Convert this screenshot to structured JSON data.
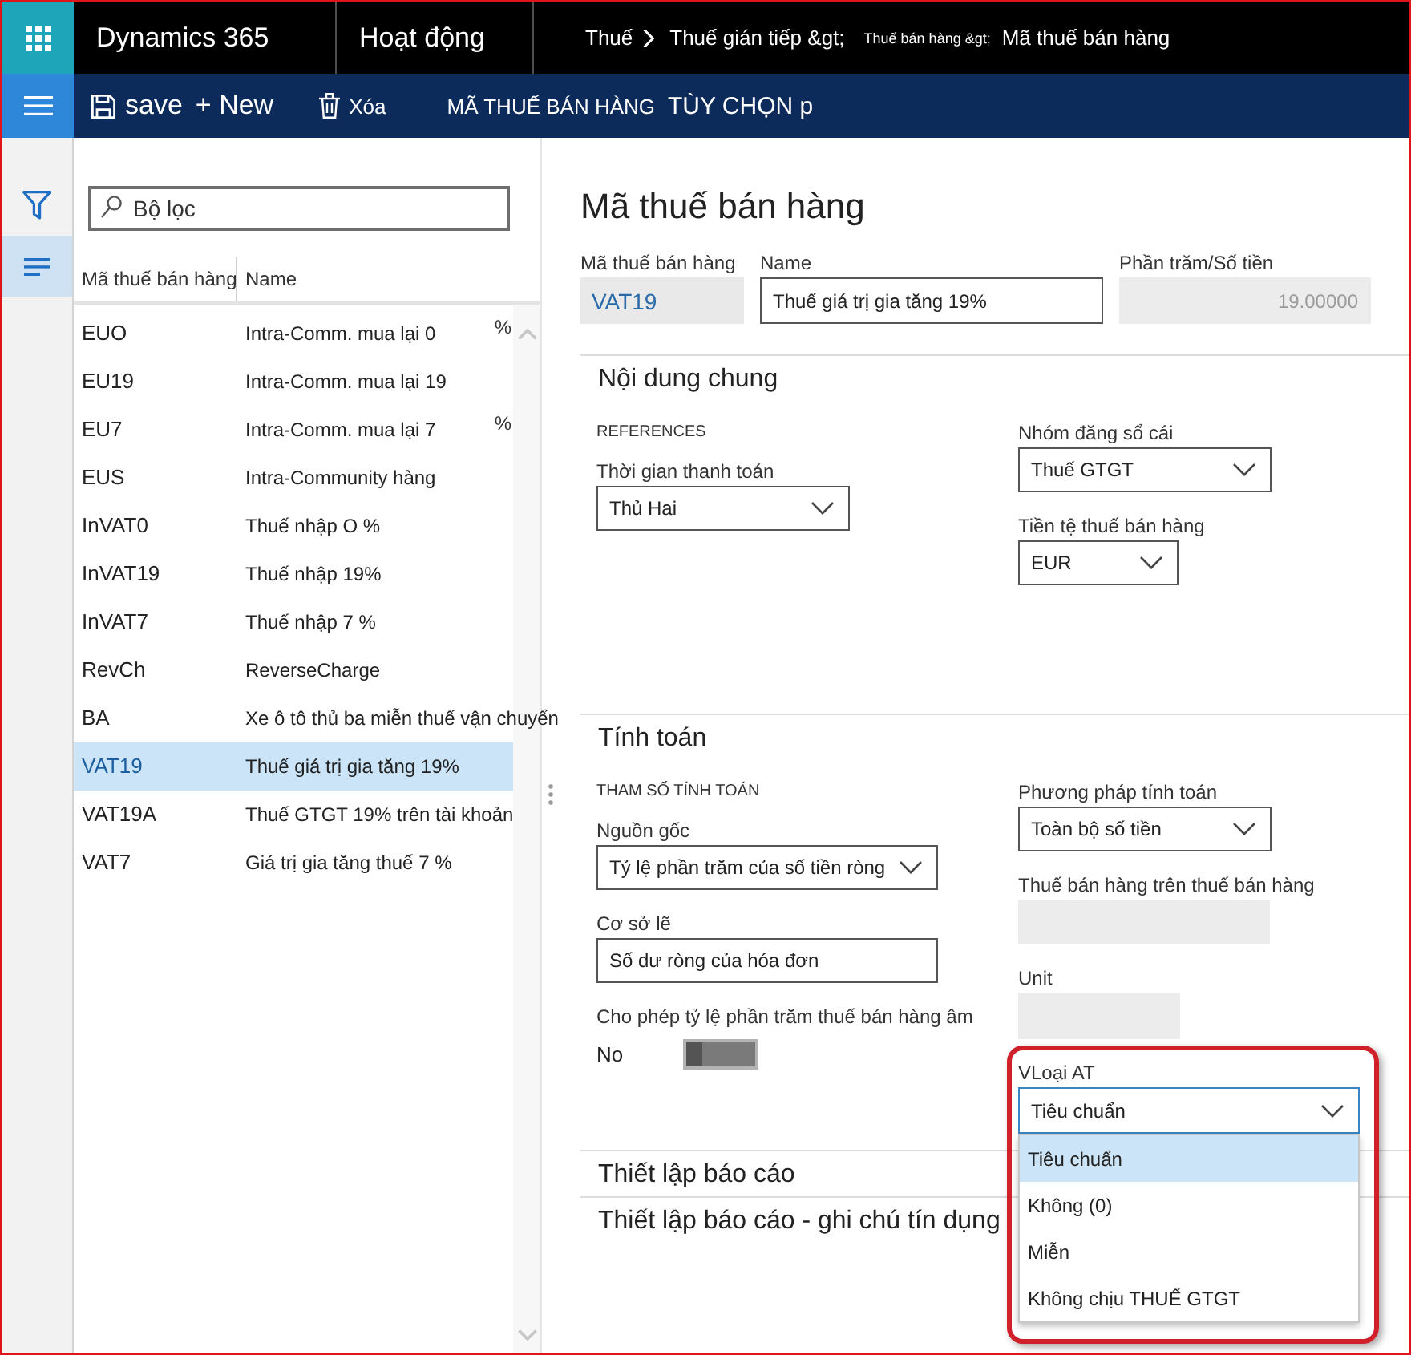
{
  "top_bar": {
    "app_name": "Dynamics 365",
    "module": "Hoạt động",
    "breadcrumb": [
      {
        "label": "Thuế",
        "kind": "root"
      },
      {
        "label": "Thuế gián tiếp &gt;",
        "kind": "crumb"
      },
      {
        "label": "Thuế bán hàng &gt;",
        "kind": "minor"
      },
      {
        "label": "Mã thuế bán hàng",
        "kind": "crumb"
      }
    ]
  },
  "command_bar": {
    "buttons": [
      {
        "kind": "save",
        "label": "save"
      },
      {
        "kind": "new",
        "label": "+ New"
      },
      {
        "kind": "delete",
        "label": "Xóa"
      },
      {
        "kind": "tab",
        "label": "MÃ THUẾ BÁN HÀNG"
      },
      {
        "kind": "tab",
        "label": "TÙY CHỌN p"
      }
    ]
  },
  "nav_rail": {
    "items": [
      {
        "kind": "filter",
        "selected": false
      },
      {
        "kind": "list",
        "selected": true
      }
    ]
  },
  "list_pane": {
    "filter": {
      "placeholder": "Bộ lọc"
    },
    "columns": [
      "Mã thuế bán hàng",
      "Name"
    ],
    "rows": [
      {
        "code": "EUO",
        "name": "Intra-Comm. mua lại 0",
        "suffix": "%",
        "selected": false
      },
      {
        "code": "EU19",
        "name": "Intra-Comm. mua lại 19",
        "selected": false
      },
      {
        "code": "EU7",
        "name": "Intra-Comm. mua lại 7",
        "suffix": "%",
        "selected": false
      },
      {
        "code": "EUS",
        "name": "Intra-Community hàng",
        "selected": false
      },
      {
        "code": "InVAT0",
        "name": "Thuế nhập O %",
        "selected": false
      },
      {
        "code": "InVAT19",
        "name": "Thuế nhập 19%",
        "selected": false
      },
      {
        "code": "InVAT7",
        "name": "Thuế nhập 7 %",
        "selected": false
      },
      {
        "code": "RevCh",
        "name": "ReverseCharge",
        "selected": false
      },
      {
        "code": "BA",
        "name": "Xe ô tô thủ ba miễn thuế vận chuyển",
        "selected": false
      },
      {
        "code": "VAT19",
        "name": "Thuế giá trị gia tăng 19%",
        "selected": true
      },
      {
        "code": "VAT19A",
        "name": "Thuế GTGT 19% trên tài khoản",
        "selected": false
      },
      {
        "code": "VAT7",
        "name": "Giá trị gia tăng thuế 7 %",
        "selected": false
      }
    ]
  },
  "detail": {
    "title": "Mã thuế bán hàng",
    "header_fields": [
      {
        "kind": "code",
        "label": "Mã thuế bán hàng",
        "value": "VAT19"
      },
      {
        "kind": "input",
        "label": "Name",
        "value": "Thuế giá trị gia tăng 19%"
      },
      {
        "kind": "number",
        "label": "Phần trăm/Số tiền",
        "value": "19.00000",
        "disabled": true
      }
    ],
    "sections": [
      {
        "title": "Nội dung chung",
        "expanded": true,
        "columns": [
          {
            "fields": [
              {
                "kind": "group",
                "label": "REFERENCES"
              },
              {
                "kind": "dropdown",
                "label": "Thời gian thanh toán",
                "value": "Thủ Hai",
                "expanded": false
              }
            ]
          },
          {
            "fields": [
              {
                "kind": "dropdown",
                "label": "Nhóm đăng sổ cái",
                "value": "Thuế GTGT",
                "expanded": false
              },
              {
                "kind": "dropdown",
                "label": "Tiền tệ thuế bán hàng",
                "value": "EUR",
                "expanded": false
              }
            ]
          }
        ]
      },
      {
        "title": "Tính toán",
        "expanded": true,
        "columns": [
          {
            "fields": [
              {
                "kind": "group",
                "label": "THAM SỐ TÍNH TOÁN"
              },
              {
                "kind": "dropdown",
                "label": "Nguồn gốc",
                "value": "Tỷ lệ phần trăm của số tiền ròng",
                "expanded": false
              },
              {
                "kind": "input",
                "label": "Cơ sở lẽ",
                "value": "Số dư ròng của hóa đơn"
              },
              {
                "kind": "toggle",
                "label": "Cho phép tỷ lệ phần trăm thuế bán hàng âm",
                "on": false,
                "state_label": "No"
              }
            ]
          },
          {
            "fields": [
              {
                "kind": "dropdown",
                "label": "Phương pháp tính toán",
                "value": "Toàn bộ số tiền",
                "expanded": false
              },
              {
                "kind": "readonly",
                "label": "Thuế bán hàng trên thuế bán hàng"
              },
              {
                "kind": "readonly",
                "label": "Unit"
              },
              {
                "kind": "dropdown",
                "label": "VLoại AT",
                "value": "Tiêu chuẩn",
                "expanded": true,
                "annotated": true,
                "options": [
                  {
                    "label": "Tiêu chuẩn",
                    "selected": true
                  },
                  {
                    "label": "Không (0)",
                    "selected": false
                  },
                  {
                    "label": "Miễn",
                    "selected": false
                  },
                  {
                    "label": "Không chịu THUẾ GTGT",
                    "selected": false
                  }
                ]
              }
            ]
          }
        ]
      },
      {
        "title": "Thiết lập báo cáo",
        "expanded": false
      },
      {
        "title": "Thiết lập báo cáo - ghi chú tín dụng",
        "expanded": false
      }
    ]
  }
}
